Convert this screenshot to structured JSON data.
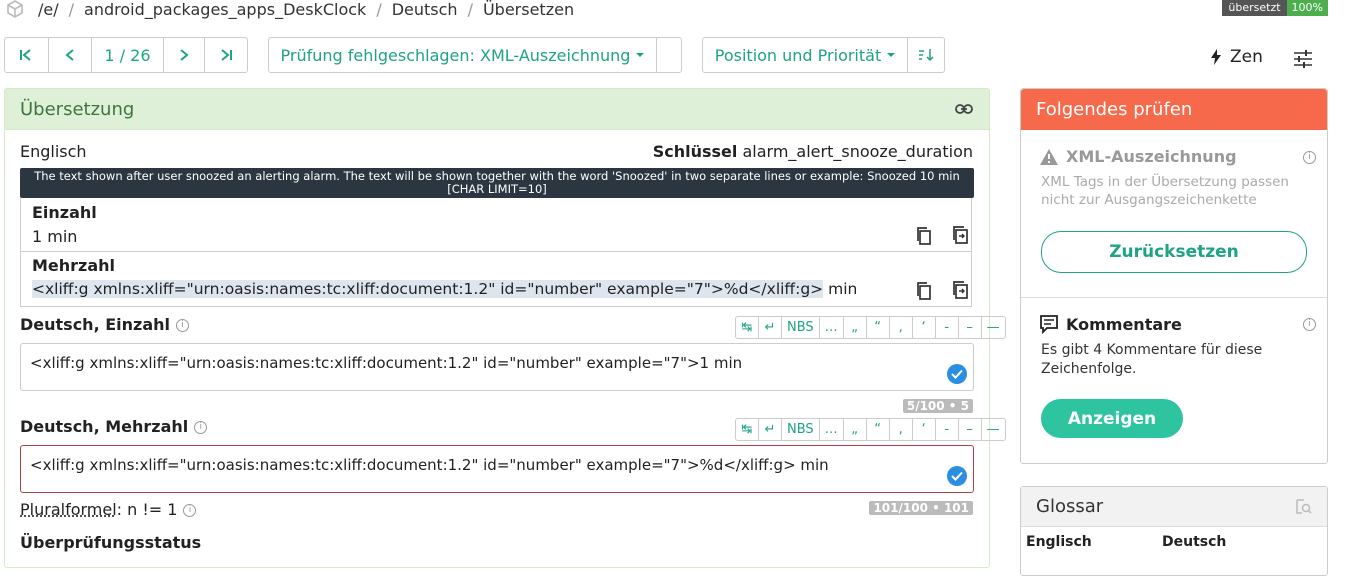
{
  "breadcrumb": [
    "/e/",
    "android_packages_apps_DeskClock",
    "Deutsch",
    "Übersetzen"
  ],
  "status_badge": {
    "label": "übersetzt",
    "percent": "100%"
  },
  "nav": {
    "position": "1 / 26"
  },
  "filter": {
    "label": "Prüfung fehlgeschlagen: XML-Auszeichnung"
  },
  "sort": {
    "label": "Position und Priorität"
  },
  "zen": {
    "label": "Zen"
  },
  "translation": {
    "title": "Übersetzung",
    "source_lang": "Englisch",
    "key_label": "Schlüssel",
    "key_value": "alarm_alert_snooze_duration",
    "context": "The text shown after user snoozed an alerting alarm. The text will be shown together with the word 'Snoozed' in two separate lines or example: Snoozed 10 min [CHAR LIMIT=10]",
    "singular_label": "Einzahl",
    "singular_text": "1 min",
    "plural_label": "Mehrzahl",
    "plural_tag": "<xliff:g xmlns:xliff=\"urn:oasis:names:tc:xliff:document:1.2\" id=\"number\" example=\"7\">%d</xliff:g>",
    "plural_rest": " min",
    "de_singular_label": "Deutsch, Einzahl",
    "de_singular_value": "<xliff:g xmlns:xliff=\"urn:oasis:names:tc:xliff:document:1.2\" id=\"number\" example=\"7\">1 min",
    "de_singular_counter": "5/100 • 5",
    "de_plural_label": "Deutsch, Mehrzahl",
    "de_plural_value": "<xliff:g xmlns:xliff=\"urn:oasis:names:tc:xliff:document:1.2\" id=\"number\" example=\"7\">%d</xliff:g> min",
    "de_plural_counter": "101/100 • 101",
    "plural_formula_label": "Pluralformel",
    "plural_formula_value": ": n != 1",
    "review_status": "Überprüfungsstatus",
    "toolbar_buttons": [
      "↹",
      "↵",
      "NBS",
      "…",
      "„",
      "“",
      ",",
      "‘",
      "-",
      "–",
      "—"
    ]
  },
  "checks": {
    "title": "Folgendes prüfen",
    "xml_title": "XML-Auszeichnung",
    "xml_desc": "XML Tags in der Übersetzung passen nicht zur Ausgangszeichenkette",
    "reset_label": "Zurücksetzen",
    "comments_title": "Kommentare",
    "comments_desc": "Es gibt 4 Kommentare für diese Zeichenfolge.",
    "show_label": "Anzeigen"
  },
  "glossary": {
    "title": "Glossar",
    "col_source": "Englisch",
    "col_target": "Deutsch"
  },
  "colors": {
    "accent": "#1fa385",
    "success_header": "#dff0d8",
    "check_header": "#f66a4b",
    "error_border": "#a94442"
  }
}
